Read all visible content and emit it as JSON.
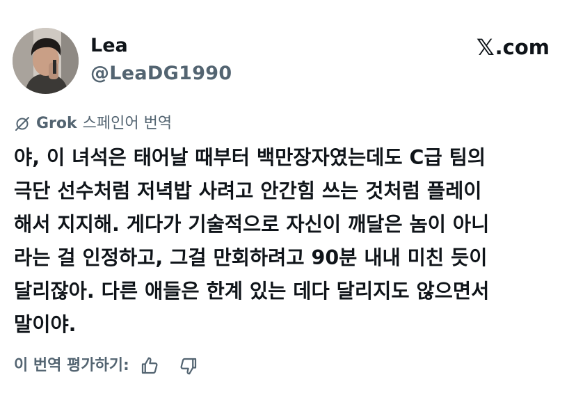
{
  "author": {
    "display_name": "Lea",
    "handle": "@LeaDG1990"
  },
  "brand": {
    "x_glyph": "𝕏",
    "suffix": ".com"
  },
  "translation": {
    "provider": "Grok",
    "label": "스페인어 번역"
  },
  "tweet": {
    "lines": [
      "야, 이 녀석은 태어날 때부터 백만장자였는데도 C급 팀의",
      "극단 선수처럼 저녁밥 사려고 안간힘 쓰는 것처럼 플레이",
      "해서 지지해. 게다가 기술적으로 자신이 깨달은 놈이 아니",
      "라는 걸 인정하고, 그걸 만회하려고 90분 내내 미친 듯이",
      "달리잖아. 다른 애들은 한계 있는 데다 달리지도 않으면서",
      "말이야."
    ]
  },
  "rating": {
    "label": "이 번역 평가하기:"
  },
  "icons": {
    "grok": "grok-icon",
    "thumbs_up": "thumbs-up-icon",
    "thumbs_down": "thumbs-down-icon"
  },
  "colors": {
    "text_primary": "#0f1419",
    "text_secondary": "#536471",
    "background": "#ffffff"
  }
}
